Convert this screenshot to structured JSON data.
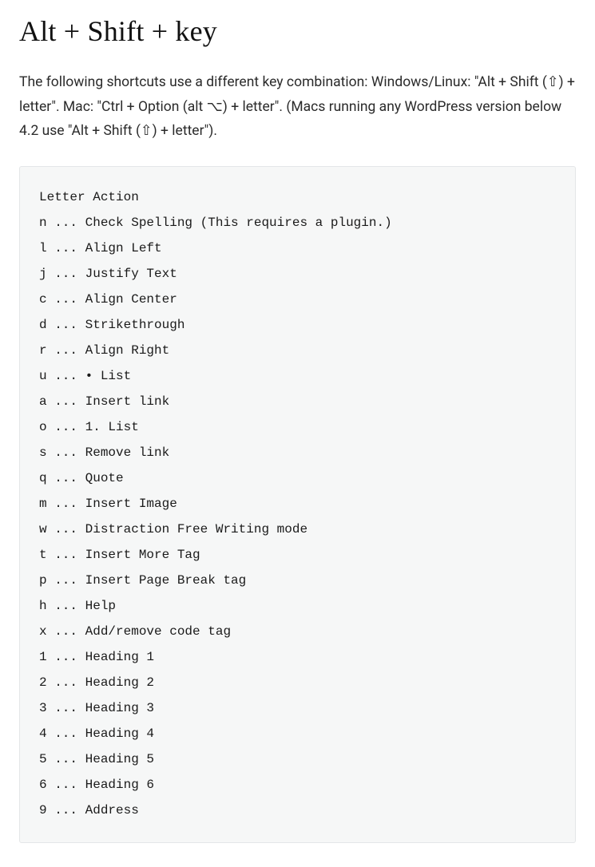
{
  "heading": "Alt + Shift + key",
  "intro": "The following shortcuts use a different key combination: Windows/Linux: \"Alt + Shift (⇧) + letter\". Mac: \"Ctrl + Option (alt ⌥) + letter\". (Macs running any WordPress version below 4.2 use \"Alt + Shift (⇧) + letter\").",
  "code": {
    "header": "Letter Action",
    "rows": [
      {
        "letter": "n",
        "action": "Check Spelling (This requires a plugin.)"
      },
      {
        "letter": "l",
        "action": "Align Left"
      },
      {
        "letter": "j",
        "action": "Justify Text"
      },
      {
        "letter": "c",
        "action": "Align Center"
      },
      {
        "letter": "d",
        "action": "Strikethrough"
      },
      {
        "letter": "r",
        "action": "Align Right"
      },
      {
        "letter": "u",
        "action": "• List"
      },
      {
        "letter": "a",
        "action": "Insert link"
      },
      {
        "letter": "o",
        "action": "1. List"
      },
      {
        "letter": "s",
        "action": "Remove link"
      },
      {
        "letter": "q",
        "action": "Quote"
      },
      {
        "letter": "m",
        "action": "Insert Image"
      },
      {
        "letter": "w",
        "action": "Distraction Free Writing mode"
      },
      {
        "letter": "t",
        "action": "Insert More Tag"
      },
      {
        "letter": "p",
        "action": "Insert Page Break tag"
      },
      {
        "letter": "h",
        "action": "Help"
      },
      {
        "letter": "x",
        "action": "Add/remove code tag"
      },
      {
        "letter": "1",
        "action": "Heading 1"
      },
      {
        "letter": "2",
        "action": "Heading 2"
      },
      {
        "letter": "3",
        "action": "Heading 3"
      },
      {
        "letter": "4",
        "action": "Heading 4"
      },
      {
        "letter": "5",
        "action": "Heading 5"
      },
      {
        "letter": "6",
        "action": "Heading 6"
      },
      {
        "letter": "9",
        "action": "Address"
      }
    ]
  }
}
